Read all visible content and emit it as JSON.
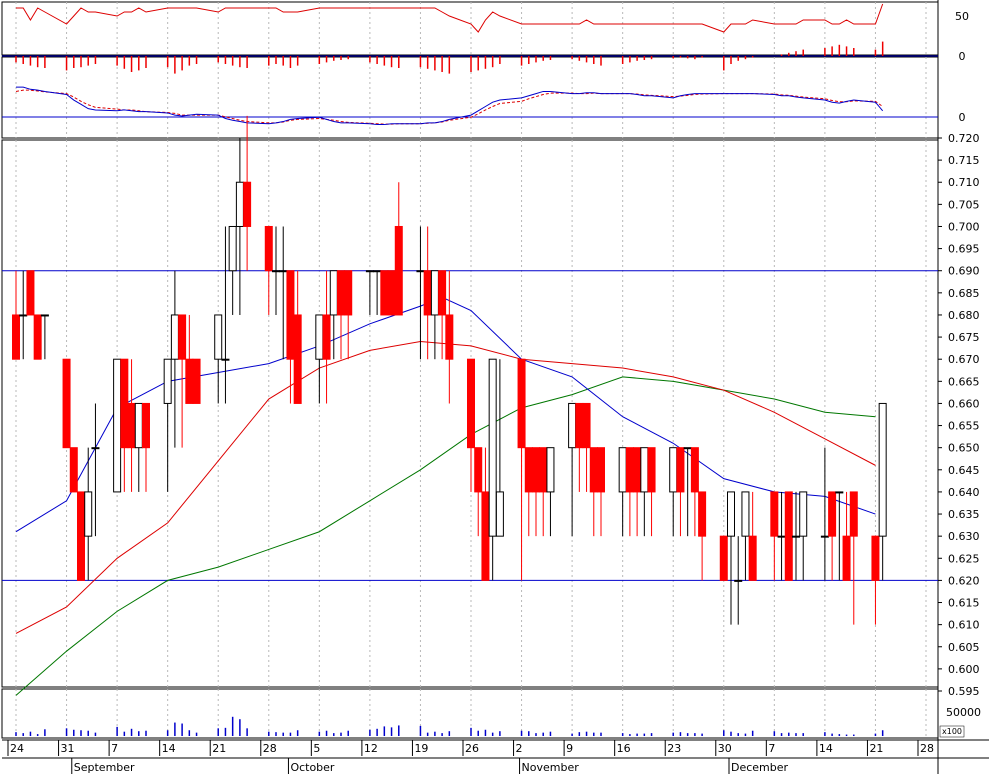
{
  "chart_data": {
    "type": "candlestick",
    "grid": true,
    "dates": [
      "08-24",
      "08-25",
      "08-26",
      "08-27",
      "08-28",
      "08-31",
      "09-01",
      "09-02",
      "09-03",
      "09-04",
      "09-07",
      "09-08",
      "09-09",
      "09-10",
      "09-11",
      "09-14",
      "09-15",
      "09-16",
      "09-17",
      "09-18",
      "09-21",
      "09-22",
      "09-23",
      "09-24",
      "09-25",
      "09-28",
      "09-29",
      "09-30",
      "10-01",
      "10-02",
      "10-05",
      "10-06",
      "10-07",
      "10-08",
      "10-09",
      "10-12",
      "10-13",
      "10-14",
      "10-15",
      "10-16",
      "10-19",
      "10-20",
      "10-21",
      "10-22",
      "10-23",
      "10-26",
      "10-27",
      "10-28",
      "10-29",
      "10-30",
      "11-02",
      "11-03",
      "11-04",
      "11-05",
      "11-06",
      "11-09",
      "11-10",
      "11-11",
      "11-12",
      "11-13",
      "11-16",
      "11-17",
      "11-18",
      "11-19",
      "11-20",
      "11-23",
      "11-24",
      "11-25",
      "11-26",
      "11-27",
      "11-30",
      "12-01",
      "12-02",
      "12-03",
      "12-04",
      "12-07",
      "12-08",
      "12-09",
      "12-10",
      "12-11",
      "12-14",
      "12-15",
      "12-16",
      "12-17",
      "12-18",
      "12-21",
      "12-22"
    ],
    "open": [
      0.68,
      0.68,
      0.69,
      0.68,
      0.68,
      0.67,
      0.65,
      0.64,
      0.63,
      0.65,
      0.64,
      0.67,
      0.66,
      0.65,
      0.66,
      0.66,
      0.67,
      0.68,
      0.67,
      0.67,
      0.67,
      0.67,
      0.69,
      0.7,
      0.71,
      0.7,
      0.69,
      0.69,
      0.69,
      0.68,
      0.67,
      0.68,
      0.68,
      0.69,
      0.69,
      0.69,
      0.69,
      0.69,
      0.69,
      0.7,
      0.69,
      0.69,
      0.68,
      0.69,
      0.68,
      0.67,
      0.65,
      0.64,
      0.63,
      0.63,
      0.67,
      0.65,
      0.65,
      0.65,
      0.64,
      0.65,
      0.66,
      0.66,
      0.65,
      0.65,
      0.64,
      0.65,
      0.65,
      0.64,
      0.65,
      0.64,
      0.65,
      0.65,
      0.65,
      0.64,
      0.63,
      0.63,
      0.62,
      0.63,
      0.63,
      0.64,
      0.63,
      0.64,
      0.63,
      0.63,
      0.63,
      0.64,
      0.64,
      0.63,
      0.64,
      0.63,
      0.63
    ],
    "high": [
      0.69,
      0.69,
      0.69,
      0.68,
      0.68,
      0.67,
      0.65,
      0.64,
      0.65,
      0.66,
      0.67,
      0.67,
      0.67,
      0.66,
      0.66,
      0.67,
      0.69,
      0.68,
      0.68,
      0.67,
      0.67,
      0.7,
      0.7,
      0.72,
      0.725,
      0.7,
      0.7,
      0.7,
      0.69,
      0.69,
      0.68,
      0.69,
      0.69,
      0.69,
      0.69,
      0.69,
      0.69,
      0.69,
      0.69,
      0.71,
      0.7,
      0.7,
      0.69,
      0.69,
      0.69,
      0.67,
      0.65,
      0.65,
      0.67,
      0.67,
      0.67,
      0.65,
      0.65,
      0.65,
      0.65,
      0.66,
      0.66,
      0.66,
      0.65,
      0.65,
      0.65,
      0.65,
      0.65,
      0.65,
      0.65,
      0.65,
      0.65,
      0.65,
      0.65,
      0.64,
      0.63,
      0.64,
      0.63,
      0.64,
      0.64,
      0.64,
      0.64,
      0.64,
      0.64,
      0.64,
      0.65,
      0.64,
      0.64,
      0.64,
      0.64,
      0.63,
      0.66
    ],
    "low": [
      0.67,
      0.67,
      0.68,
      0.67,
      0.67,
      0.65,
      0.64,
      0.62,
      0.62,
      0.63,
      0.64,
      0.64,
      0.64,
      0.64,
      0.64,
      0.64,
      0.65,
      0.65,
      0.66,
      0.66,
      0.66,
      0.66,
      0.68,
      0.68,
      0.69,
      0.68,
      0.68,
      0.67,
      0.66,
      0.66,
      0.66,
      0.66,
      0.67,
      0.67,
      0.67,
      0.68,
      0.68,
      0.68,
      0.68,
      0.68,
      0.67,
      0.67,
      0.67,
      0.67,
      0.66,
      0.64,
      0.63,
      0.62,
      0.62,
      0.63,
      0.62,
      0.63,
      0.63,
      0.63,
      0.63,
      0.63,
      0.64,
      0.64,
      0.63,
      0.63,
      0.63,
      0.63,
      0.63,
      0.63,
      0.63,
      0.63,
      0.63,
      0.63,
      0.63,
      0.62,
      0.62,
      0.61,
      0.61,
      0.62,
      0.62,
      0.62,
      0.62,
      0.62,
      0.62,
      0.62,
      0.62,
      0.62,
      0.62,
      0.62,
      0.61,
      0.61,
      0.62
    ],
    "close": [
      0.67,
      0.68,
      0.68,
      0.67,
      0.68,
      0.65,
      0.64,
      0.62,
      0.64,
      0.65,
      0.67,
      0.65,
      0.65,
      0.66,
      0.65,
      0.67,
      0.68,
      0.67,
      0.66,
      0.66,
      0.68,
      0.67,
      0.7,
      0.71,
      0.7,
      0.69,
      0.69,
      0.69,
      0.67,
      0.66,
      0.68,
      0.67,
      0.69,
      0.68,
      0.68,
      0.69,
      0.69,
      0.68,
      0.68,
      0.68,
      0.69,
      0.68,
      0.69,
      0.68,
      0.67,
      0.65,
      0.64,
      0.62,
      0.67,
      0.64,
      0.65,
      0.64,
      0.64,
      0.64,
      0.65,
      0.66,
      0.65,
      0.65,
      0.64,
      0.64,
      0.65,
      0.64,
      0.64,
      0.65,
      0.64,
      0.65,
      0.64,
      0.65,
      0.64,
      0.63,
      0.62,
      0.64,
      0.62,
      0.64,
      0.62,
      0.63,
      0.63,
      0.62,
      0.63,
      0.64,
      0.63,
      0.63,
      0.64,
      0.62,
      0.63,
      0.62,
      0.66
    ],
    "volume": [
      800,
      600,
      900,
      400,
      1400,
      1600,
      1300,
      1200,
      1100,
      700,
      1900,
      900,
      1500,
      1000,
      1100,
      1200,
      2800,
      2600,
      1200,
      700,
      1600,
      1700,
      4000,
      3500,
      1600,
      900,
      800,
      700,
      700,
      1200,
      900,
      1100,
      600,
      700,
      1100,
      1300,
      1500,
      2000,
      1800,
      2200,
      2100,
      700,
      900,
      600,
      1000,
      1700,
      1100,
      1300,
      700,
      1000,
      1100,
      1000,
      600,
      700,
      900,
      500,
      800,
      900,
      700,
      700,
      600,
      400,
      500,
      500,
      600,
      700,
      800,
      600,
      600,
      500,
      1200,
      900,
      600,
      500,
      1100,
      1000,
      600,
      700,
      600,
      600,
      800,
      500,
      400,
      300,
      300,
      500,
      1200
    ],
    "ma_blue_points": [
      [
        "08-24",
        0.631
      ],
      [
        "08-31",
        0.638
      ],
      [
        "09-07",
        0.659
      ],
      [
        "09-14",
        0.665
      ],
      [
        "09-21",
        0.667
      ],
      [
        "09-28",
        0.669
      ],
      [
        "10-05",
        0.673
      ],
      [
        "10-12",
        0.678
      ],
      [
        "10-19",
        0.682
      ],
      [
        "10-22",
        0.684
      ],
      [
        "10-26",
        0.681
      ],
      [
        "11-02",
        0.67
      ],
      [
        "11-09",
        0.666
      ],
      [
        "11-16",
        0.657
      ],
      [
        "11-23",
        0.651
      ],
      [
        "11-30",
        0.643
      ],
      [
        "12-07",
        0.64
      ],
      [
        "12-14",
        0.639
      ],
      [
        "12-21",
        0.635
      ]
    ],
    "ma_red_points": [
      [
        "08-24",
        0.608
      ],
      [
        "08-31",
        0.614
      ],
      [
        "09-07",
        0.625
      ],
      [
        "09-14",
        0.633
      ],
      [
        "09-21",
        0.647
      ],
      [
        "09-28",
        0.661
      ],
      [
        "10-05",
        0.668
      ],
      [
        "10-12",
        0.672
      ],
      [
        "10-19",
        0.674
      ],
      [
        "10-26",
        0.673
      ],
      [
        "11-02",
        0.67
      ],
      [
        "11-09",
        0.669
      ],
      [
        "11-16",
        0.668
      ],
      [
        "11-23",
        0.666
      ],
      [
        "11-30",
        0.663
      ],
      [
        "12-07",
        0.658
      ],
      [
        "12-14",
        0.652
      ],
      [
        "12-21",
        0.646
      ]
    ],
    "ma_green_points": [
      [
        "08-24",
        0.594
      ],
      [
        "08-31",
        0.604
      ],
      [
        "09-07",
        0.613
      ],
      [
        "09-14",
        0.62
      ],
      [
        "09-21",
        0.623
      ],
      [
        "09-28",
        0.627
      ],
      [
        "10-05",
        0.631
      ],
      [
        "10-12",
        0.638
      ],
      [
        "10-19",
        0.645
      ],
      [
        "10-26",
        0.653
      ],
      [
        "11-02",
        0.659
      ],
      [
        "11-09",
        0.662
      ],
      [
        "11-16",
        0.666
      ],
      [
        "11-23",
        0.665
      ],
      [
        "11-30",
        0.663
      ],
      [
        "12-07",
        0.661
      ],
      [
        "12-14",
        0.658
      ],
      [
        "12-21",
        0.657
      ]
    ],
    "indicator1_line": [
      60,
      60,
      45,
      60,
      55,
      40,
      50,
      60,
      55,
      55,
      50,
      55,
      55,
      60,
      55,
      60,
      60,
      60,
      60,
      60,
      55,
      60,
      60,
      60,
      60,
      60,
      60,
      55,
      55,
      55,
      60,
      60,
      60,
      60,
      60,
      60,
      60,
      60,
      60,
      60,
      60,
      60,
      60,
      55,
      50,
      40,
      30,
      45,
      55,
      50,
      40,
      40,
      40,
      40,
      40,
      40,
      40,
      45,
      40,
      40,
      40,
      40,
      40,
      40,
      40,
      40,
      40,
      40,
      40,
      40,
      30,
      40,
      40,
      40,
      45,
      40,
      40,
      40,
      40,
      45,
      45,
      40,
      40,
      45,
      40,
      40,
      65
    ],
    "indicator1_hist": [
      -8,
      -10,
      -12,
      -14,
      -15,
      -18,
      -15,
      -14,
      -12,
      -10,
      -12,
      -16,
      -20,
      -18,
      -15,
      -14,
      -22,
      -18,
      -12,
      -10,
      -8,
      -10,
      -12,
      -14,
      -15,
      -12,
      -10,
      -12,
      -15,
      -12,
      -10,
      -8,
      -6,
      -5,
      -4,
      -8,
      -10,
      -12,
      -14,
      -15,
      -14,
      -16,
      -18,
      -20,
      -22,
      -20,
      -18,
      -16,
      -14,
      -10,
      -12,
      -10,
      -8,
      -6,
      -5,
      -4,
      -6,
      -8,
      -10,
      -12,
      -10,
      -8,
      -6,
      -5,
      -4,
      -3,
      -2,
      -3,
      -4,
      -2,
      -18,
      -10,
      -6,
      -4,
      -2,
      0,
      2,
      4,
      6,
      8,
      10,
      12,
      14,
      12,
      10,
      8,
      18
    ],
    "indicator2_blue": [
      0.95,
      0.95,
      0.9,
      0.88,
      0.85,
      0.78,
      0.65,
      0.55,
      0.45,
      0.42,
      0.4,
      0.42,
      0.4,
      0.38,
      0.38,
      0.35,
      0.3,
      0.28,
      0.3,
      0.32,
      0.3,
      0.22,
      0.18,
      0.15,
      0.12,
      0.1,
      0.12,
      0.15,
      0.2,
      0.22,
      0.25,
      0.2,
      0.15,
      0.12,
      0.12,
      0.1,
      0.08,
      0.08,
      0.1,
      0.1,
      0.1,
      0.12,
      0.12,
      0.15,
      0.2,
      0.3,
      0.4,
      0.5,
      0.6,
      0.65,
      0.7,
      0.75,
      0.8,
      0.85,
      0.85,
      0.8,
      0.8,
      0.82,
      0.82,
      0.8,
      0.8,
      0.8,
      0.78,
      0.75,
      0.75,
      0.7,
      0.75,
      0.78,
      0.8,
      0.8,
      0.8,
      0.8,
      0.8,
      0.8,
      0.8,
      0.78,
      0.75,
      0.75,
      0.72,
      0.7,
      0.65,
      0.6,
      0.58,
      0.62,
      0.65,
      0.6,
      0.4
    ],
    "indicator2_red": [
      0.85,
      0.88,
      0.88,
      0.86,
      0.84,
      0.8,
      0.72,
      0.62,
      0.54,
      0.48,
      0.44,
      0.42,
      0.42,
      0.4,
      0.38,
      0.36,
      0.34,
      0.3,
      0.3,
      0.3,
      0.3,
      0.26,
      0.22,
      0.18,
      0.15,
      0.12,
      0.12,
      0.14,
      0.18,
      0.2,
      0.22,
      0.2,
      0.18,
      0.15,
      0.13,
      0.11,
      0.1,
      0.09,
      0.09,
      0.1,
      0.1,
      0.11,
      0.12,
      0.14,
      0.18,
      0.25,
      0.33,
      0.42,
      0.5,
      0.57,
      0.62,
      0.68,
      0.73,
      0.78,
      0.81,
      0.81,
      0.8,
      0.8,
      0.81,
      0.8,
      0.8,
      0.8,
      0.79,
      0.77,
      0.76,
      0.73,
      0.74,
      0.76,
      0.78,
      0.79,
      0.8,
      0.8,
      0.8,
      0.8,
      0.8,
      0.79,
      0.77,
      0.76,
      0.74,
      0.72,
      0.68,
      0.64,
      0.61,
      0.61,
      0.63,
      0.62,
      0.5
    ],
    "price_ylim": [
      0.59,
      0.73
    ],
    "price_ticks": [
      "0.720",
      "0.715",
      "0.710",
      "0.705",
      "0.700",
      "0.695",
      "0.690",
      "0.685",
      "0.680",
      "0.675",
      "0.670",
      "0.665",
      "0.660",
      "0.655",
      "0.650",
      "0.645",
      "0.640",
      "0.635",
      "0.630",
      "0.625",
      "0.620",
      "0.615",
      "0.610",
      "0.605",
      "0.600",
      "0.595"
    ],
    "price_ref_lines": [
      0.69,
      0.62
    ],
    "indicator1_ticks": [
      "50",
      "0"
    ],
    "indicator2_ticks": [
      "0"
    ],
    "volume_tick": "50000",
    "volume_unit": "x100",
    "day_labels": [
      [
        "24",
        "08-24"
      ],
      [
        "31",
        "08-31"
      ],
      [
        "7",
        "09-07"
      ],
      [
        "14",
        "09-14"
      ],
      [
        "21",
        "09-21"
      ],
      [
        "28",
        "09-28"
      ],
      [
        "5",
        "10-05"
      ],
      [
        "12",
        "10-12"
      ],
      [
        "19",
        "10-19"
      ],
      [
        "26",
        "10-26"
      ],
      [
        "2",
        "11-02"
      ],
      [
        "9",
        "11-09"
      ],
      [
        "16",
        "11-16"
      ],
      [
        "23",
        "11-23"
      ],
      [
        "30",
        "11-30"
      ],
      [
        "7",
        "12-07"
      ],
      [
        "14",
        "12-14"
      ],
      [
        "21",
        "12-21"
      ],
      [
        "28",
        "12-28"
      ]
    ],
    "month_labels": [
      [
        "September",
        "09-01"
      ],
      [
        "October",
        "10-01"
      ],
      [
        "November",
        "11-02"
      ],
      [
        "December",
        "12-01"
      ]
    ],
    "colors": {
      "up": "#000000",
      "down": "#ff0000",
      "ma_blue": "#0000cc",
      "ma_red": "#dd0000",
      "ma_green": "#007700",
      "ref": "#0000cc",
      "volume": "#0000cc",
      "indicator_line": "#dd0000",
      "indicator_hist": "#ee0000"
    }
  }
}
